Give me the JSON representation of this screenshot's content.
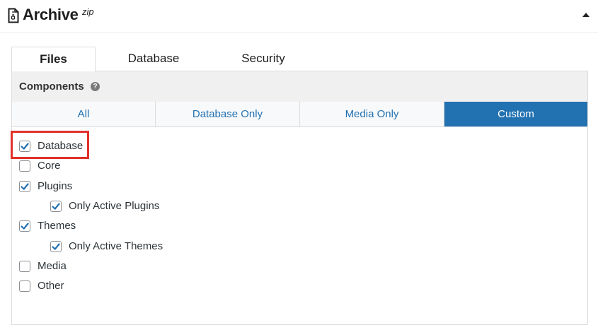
{
  "header": {
    "title": "Archive",
    "title_suffix": "zip",
    "file_icon": "file-zip-icon",
    "toggle_icon": "caret-up-icon"
  },
  "tabs": [
    {
      "label": "Files",
      "active": true
    },
    {
      "label": "Database",
      "active": false
    },
    {
      "label": "Security",
      "active": false
    }
  ],
  "components": {
    "title": "Components",
    "help_icon": "question-circle-icon",
    "help_glyph": "?",
    "filters": [
      {
        "label": "All",
        "active": false
      },
      {
        "label": "Database Only",
        "active": false
      },
      {
        "label": "Media Only",
        "active": false
      },
      {
        "label": "Custom",
        "active": true
      }
    ],
    "options": [
      {
        "label": "Database",
        "checked": true,
        "indent": 0
      },
      {
        "label": "Core",
        "checked": false,
        "indent": 0
      },
      {
        "label": "Plugins",
        "checked": true,
        "indent": 0
      },
      {
        "label": "Only Active Plugins",
        "checked": true,
        "indent": 1
      },
      {
        "label": "Themes",
        "checked": true,
        "indent": 0
      },
      {
        "label": "Only Active Themes",
        "checked": true,
        "indent": 1
      },
      {
        "label": "Media",
        "checked": false,
        "indent": 0
      },
      {
        "label": "Other",
        "checked": false,
        "indent": 0
      }
    ]
  },
  "colors": {
    "accent": "#2271b1",
    "highlight": "#e0312a"
  }
}
